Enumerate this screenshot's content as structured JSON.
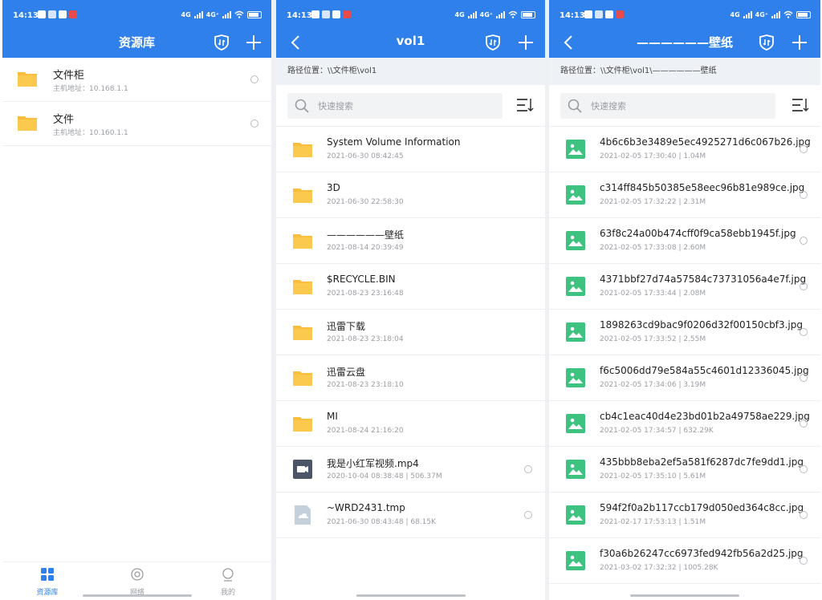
{
  "status": {
    "time": "14:13",
    "net1": "4G",
    "net2": "4G⁺",
    "battery": "100"
  },
  "screen1": {
    "title": "资源库",
    "items": [
      {
        "name": "文件柜",
        "host": "主机地址：10.168.1.1"
      },
      {
        "name": "文件",
        "host": "主机地址：10.160.1.1"
      }
    ],
    "nav": [
      {
        "label": "资源库"
      },
      {
        "label": "网络"
      },
      {
        "label": "我的"
      }
    ]
  },
  "screen2": {
    "title": "vol1",
    "path": "路径位置：\\\\文件柜\\vol1",
    "search_placeholder": "快速搜索",
    "items": [
      {
        "name": "System Volume Information",
        "meta": "2021-06-30  08:42:45",
        "kind": "folder"
      },
      {
        "name": "3D",
        "meta": "2021-06-30  22:58:30",
        "kind": "folder"
      },
      {
        "name": "——————壁纸",
        "meta": "2021-08-14  20:39:49",
        "kind": "folder"
      },
      {
        "name": "$RECYCLE.BIN",
        "meta": "2021-08-23  23:16:48",
        "kind": "folder"
      },
      {
        "name": "迅雷下载",
        "meta": "2021-08-23  23:18:04",
        "kind": "folder"
      },
      {
        "name": "迅雷云盘",
        "meta": "2021-08-23  23:18:10",
        "kind": "folder"
      },
      {
        "name": "MI",
        "meta": "2021-08-24  21:16:20",
        "kind": "folder"
      },
      {
        "name": "我是小红军视频.mp4",
        "meta": "2020-10-04  08:38:48   |   506.37M",
        "kind": "video"
      },
      {
        "name": "~WRD2431.tmp",
        "meta": "2021-06-30  08:43:48   |   68.15K",
        "kind": "file"
      }
    ]
  },
  "screen3": {
    "title": "——————壁纸",
    "path": "路径位置：\\\\文件柜\\vol1\\——————壁纸",
    "search_placeholder": "快速搜索",
    "items": [
      {
        "name": "4b6c6b3e3489e5ec4925271d6c067b26.jpg",
        "meta": "2021-02-05  17:30:40   |   1.04M"
      },
      {
        "name": "c314ff845b50385e58eec96b81e989ce.jpg",
        "meta": "2021-02-05  17:32:22   |   2.31M"
      },
      {
        "name": "63f8c24a00b474cff0f9ca58ebb1945f.jpg",
        "meta": "2021-02-05  17:33:08   |   2.60M"
      },
      {
        "name": "4371bbf27d74a57584c73731056a4e7f.jpg",
        "meta": "2021-02-05  17:33:44   |   2.08M"
      },
      {
        "name": "1898263cd9bac9f0206d32f00150cbf3.jpg",
        "meta": "2021-02-05  17:33:52   |   2.55M"
      },
      {
        "name": "f6c5006dd79e584a55c4601d12336045.jpg",
        "meta": "2021-02-05  17:34:06   |   3.19M"
      },
      {
        "name": "cb4c1eac40d4e23bd01b2a49758ae229.jpg",
        "meta": "2021-02-05  17:34:57   |   632.29K"
      },
      {
        "name": "435bbb8eba2ef5a581f6287dc7fe9dd1.jpg",
        "meta": "2021-02-05  17:35:10   |   5.61M"
      },
      {
        "name": "594f2f0a2b117ccb179d050ed364c8cc.jpg",
        "meta": "2021-02-17  17:53:13   |   1.51M"
      },
      {
        "name": "f30a6b26247cc6973fed942fb56a2d25.jpg",
        "meta": "2021-03-02  17:32:32   |   1005.28K"
      }
    ]
  },
  "colors": {
    "accent": "#2f80ea",
    "folder": "#fbbd3c",
    "image": "#3ec27f",
    "video": "#4b5567",
    "file": "#c5d0dd"
  }
}
